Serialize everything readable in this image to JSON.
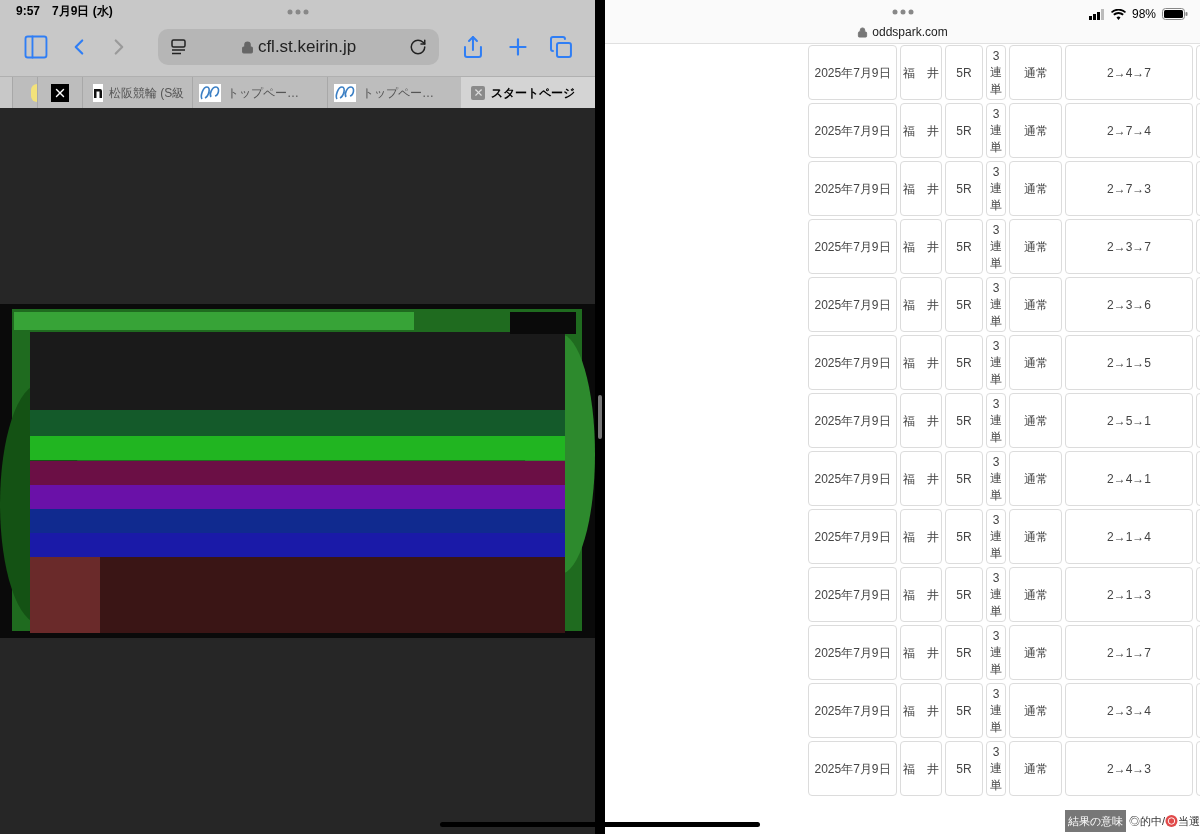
{
  "left_pane": {
    "status": {
      "time": "9:57",
      "date": "7月9日 (水)"
    },
    "address_bar": {
      "url": "cfl.st.keirin.jp"
    },
    "tabs": [
      {
        "selected": false
      },
      {
        "selected": false
      },
      {
        "label": "松阪競輪 (S級",
        "selected": false
      },
      {
        "label": "トップペー…",
        "selected": false
      },
      {
        "label": "トップペー…",
        "selected": false
      },
      {
        "label": "スタートページ",
        "selected": true
      }
    ]
  },
  "right_pane": {
    "status": {
      "battery": "98%"
    },
    "address": "oddspark.com",
    "table": {
      "rows": [
        {
          "date": "2025年7月9日",
          "venue": "福　井",
          "race": "5R",
          "type": "3連単",
          "mode": "通常",
          "result": "2→4→7"
        },
        {
          "date": "2025年7月9日",
          "venue": "福　井",
          "race": "5R",
          "type": "3連単",
          "mode": "通常",
          "result": "2→7→4"
        },
        {
          "date": "2025年7月9日",
          "venue": "福　井",
          "race": "5R",
          "type": "3連単",
          "mode": "通常",
          "result": "2→7→3"
        },
        {
          "date": "2025年7月9日",
          "venue": "福　井",
          "race": "5R",
          "type": "3連単",
          "mode": "通常",
          "result": "2→3→7"
        },
        {
          "date": "2025年7月9日",
          "venue": "福　井",
          "race": "5R",
          "type": "3連単",
          "mode": "通常",
          "result": "2→3→6"
        },
        {
          "date": "2025年7月9日",
          "venue": "福　井",
          "race": "5R",
          "type": "3連単",
          "mode": "通常",
          "result": "2→1→5"
        },
        {
          "date": "2025年7月9日",
          "venue": "福　井",
          "race": "5R",
          "type": "3連単",
          "mode": "通常",
          "result": "2→5→1"
        },
        {
          "date": "2025年7月9日",
          "venue": "福　井",
          "race": "5R",
          "type": "3連単",
          "mode": "通常",
          "result": "2→4→1"
        },
        {
          "date": "2025年7月9日",
          "venue": "福　井",
          "race": "5R",
          "type": "3連単",
          "mode": "通常",
          "result": "2→1→4"
        },
        {
          "date": "2025年7月9日",
          "venue": "福　井",
          "race": "5R",
          "type": "3連単",
          "mode": "通常",
          "result": "2→1→3"
        },
        {
          "date": "2025年7月9日",
          "venue": "福　井",
          "race": "5R",
          "type": "3連単",
          "mode": "通常",
          "result": "2→1→7"
        },
        {
          "date": "2025年7月9日",
          "venue": "福　井",
          "race": "5R",
          "type": "3連単",
          "mode": "通常",
          "result": "2→3→4"
        },
        {
          "date": "2025年7月9日",
          "venue": "福　井",
          "race": "5R",
          "type": "3連単",
          "mode": "通常",
          "result": "2→4→3"
        }
      ]
    },
    "legend": {
      "label": "結果の意味",
      "hit": "◎的中/",
      "win": "当選"
    }
  }
}
